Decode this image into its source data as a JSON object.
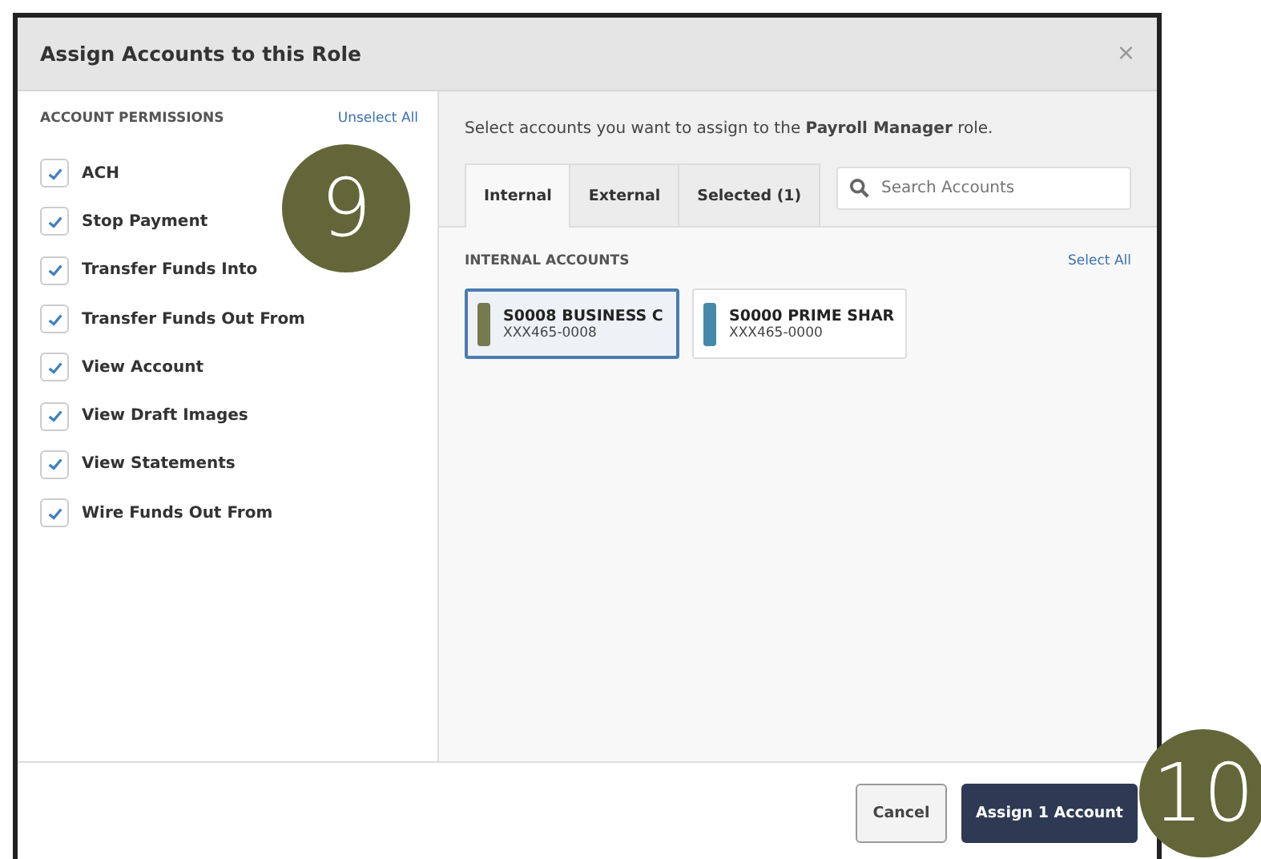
{
  "dialog": {
    "title": "Assign Accounts to this Role",
    "close": "×"
  },
  "permissions": {
    "heading": "ACCOUNT PERMISSIONS",
    "unselect_all": "Unselect All",
    "items": [
      {
        "label": "ACH",
        "checked": true
      },
      {
        "label": "Stop Payment",
        "checked": true
      },
      {
        "label": "Transfer Funds Into",
        "checked": true
      },
      {
        "label": "Transfer Funds Out From",
        "checked": true
      },
      {
        "label": "View Account",
        "checked": true
      },
      {
        "label": "View Draft Images",
        "checked": true
      },
      {
        "label": "View Statements",
        "checked": true
      },
      {
        "label": "Wire Funds Out From",
        "checked": true
      }
    ]
  },
  "intro": "Select accounts you want to assign to the **Payroll Manager** role.",
  "tabs": [
    {
      "label": "Internal",
      "selected": true
    },
    {
      "label": "External",
      "selected": false
    },
    {
      "label": "Selected (1)",
      "selected": false
    }
  ],
  "search": {
    "placeholder": "Search Accounts"
  },
  "accounts_heading": "INTERNAL ACCOUNTS",
  "select_all": "Select All",
  "accounts": [
    {
      "name": "S0008 BUSINESS C",
      "number": "XXX465-0008",
      "color": "#767a50",
      "selected": true
    },
    {
      "name": "S0000 PRIME SHAR",
      "number": "XXX465-0000",
      "color": "#4589aa",
      "selected": false
    }
  ],
  "buttons": {
    "cancel": "Cancel",
    "assign": "Assign 1 Account"
  },
  "callouts": [
    "9",
    "10"
  ]
}
